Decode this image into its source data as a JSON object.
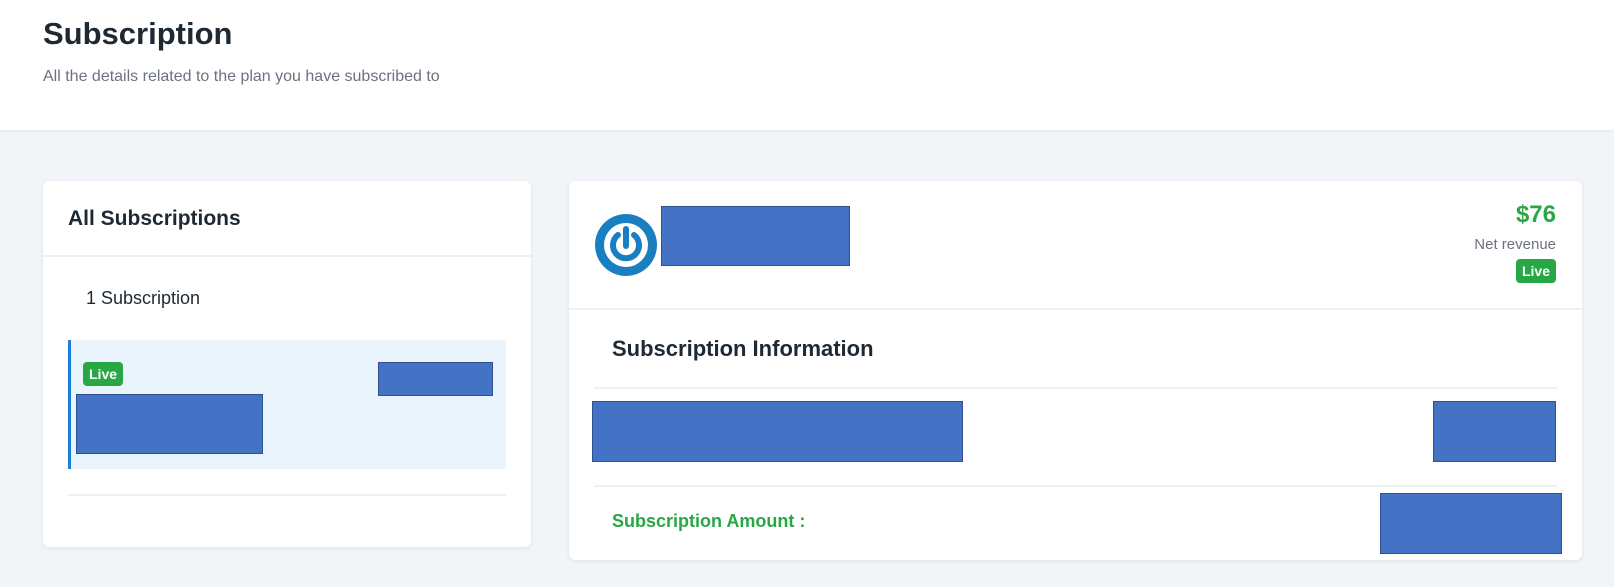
{
  "header": {
    "title": "Subscription",
    "subtitle": "All the details related to the plan you have subscribed to"
  },
  "subscriptions_panel": {
    "heading": "All Subscriptions",
    "count_label": "1 Subscription",
    "items": [
      {
        "status": "Live"
      }
    ]
  },
  "detail_panel": {
    "logo_icon": "power-icon",
    "net_revenue": "$76",
    "net_revenue_label": "Net revenue",
    "status": "Live",
    "info_heading": "Subscription Information",
    "amount_label": "Subscription Amount :"
  },
  "colors": {
    "accent_blue": "#1c7fd8",
    "live_green": "#28a745",
    "redaction_blue": "#4472c4",
    "background": "#f1f5f8"
  }
}
